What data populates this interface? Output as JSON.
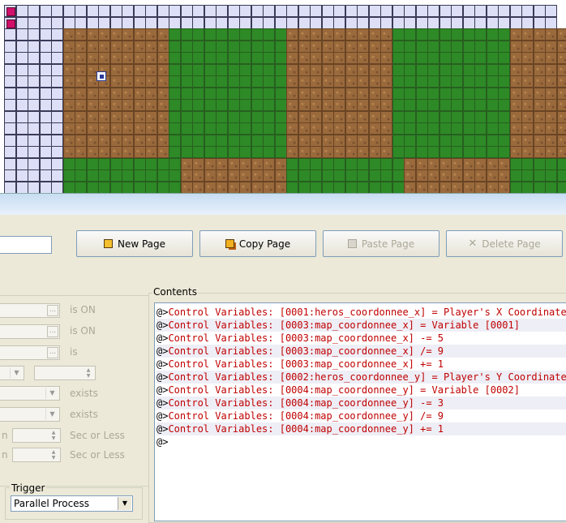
{
  "map": {
    "colors": {
      "grid": "#dcdff5",
      "grass": "#2e8a26",
      "dirt": "#9a6a3c",
      "marker": "#d0106a"
    },
    "rows": [
      "MGGGGGGGGGGGGGGGGGGGGGGGGGGGGGGGGGGGGGGGGGGGGGG",
      "MGGGGGGGGGGGGGGGGGGGGGGGGGGGGGGGGGGGGGGGGGGGGGG",
      "GGGGGDDDDDDDDDAAAAAAAAAADDDDDDDDDAAAAAAAAAADDDDD",
      "GGGGGDDDDDDDDDAAAAAAAAAADDDDDDDDDAAAAAAAAAADDDDD",
      "GGGGGDDDDDDDDDAAAAAAAAAADDDDDDDDDAAAAAAAAAADDDDD",
      "GGGGGDDDDDDDDDAAAAAAAAAADDDDDDDDDAAAAAAAAAADDDDD",
      "GGGGGDDDDDDDDDAAAAAAAAAADDDDDDDDDAAAAAAAAAADDDDD",
      "GGGGGDDDDDDDDDAAAAAAAAAADDDDDDDDDAAAAAAAAAADDDDD",
      "GGGGGDDDDDDDDDAAAAAAAAAADDDDDDDDDAAAAAAAAAADDDDD",
      "GGGGGDDDDDDDDDAAAAAAAAAADDDDDDDDDAAAAAAAAAADDDDD",
      "GGGGGDDDDDDDDDAAAAAAAAAADDDDDDDDDAAAAAAAAAADDDDD",
      "GGGGGDDDDDDDDDAAAAAAAAAADDDDDDDDDAAAAAAAAAADDDDD",
      "GGGGGDDDDDDDDDAAAAAAAAAADDDDDDDDDAAAAAAAAAADDDDD",
      "GGGGGAAAAAAAAAADDDDDDDDDAAAAAAAAAADDDDDDDDDAAAAA",
      "GGGGGAAAAAAAAAADDDDDDDDDAAAAAAAAAADDDDDDDDDAAAAA",
      "GGGGGAAAAAAAAAADDDDDDDDDAAAAAAAAAADDDDDDDDDAAAAA"
    ]
  },
  "toolbar": {
    "new_page": "New Page",
    "copy_page": "Copy Page",
    "paste_page": "Paste Page",
    "delete_page": "Delete Page"
  },
  "conditions": {
    "is_on_1": "is ON",
    "is_on_2": "is ON",
    "is": "is",
    "exists_1": "exists",
    "exists_2": "exists",
    "sec_or_less_1": "Sec or Less",
    "sec_or_less_2": "Sec or Less",
    "cut_n_1": "n",
    "cut_n_2": "n"
  },
  "trigger": {
    "label": "Trigger",
    "value": "Parallel Process"
  },
  "contents": {
    "label": "Contents",
    "commands": [
      {
        "prefix": "@>",
        "text": "Control Variables: [0001:heros_coordonnee_x] = Player's X Coordinate"
      },
      {
        "prefix": "@>",
        "text": "Control Variables: [0003:map_coordonnee_x] = Variable [0001]"
      },
      {
        "prefix": "@>",
        "text": "Control Variables: [0003:map_coordonnee_x] -= 5"
      },
      {
        "prefix": "@>",
        "text": "Control Variables: [0003:map_coordonnee_x] /= 9"
      },
      {
        "prefix": "@>",
        "text": "Control Variables: [0003:map_coordonnee_x] += 1"
      },
      {
        "prefix": "@>",
        "text": "Control Variables: [0002:heros_coordonnee_y] = Player's Y Coordinate"
      },
      {
        "prefix": "@>",
        "text": "Control Variables: [0004:map_coordonnee_y] = Variable [0002]"
      },
      {
        "prefix": "@>",
        "text": "Control Variables: [0004:map_coordonnee_y] -= 3"
      },
      {
        "prefix": "@>",
        "text": "Control Variables: [0004:map_coordonnee_y] /= 9"
      },
      {
        "prefix": "@>",
        "text": "Control Variables: [0004:map_coordonnee_y] += 1"
      },
      {
        "prefix": "@>",
        "text": ""
      }
    ]
  }
}
